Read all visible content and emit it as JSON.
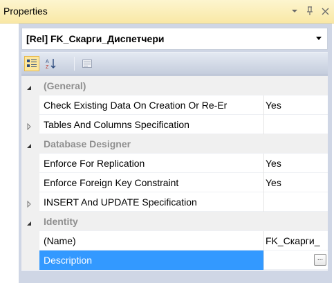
{
  "panel": {
    "title": "Properties",
    "pin_glyph": "▾ ⊥",
    "close_glyph": "✕"
  },
  "object_selector": {
    "value": "[Rel] FK_Скарги_Диспетчери"
  },
  "toolbar": {
    "categorized_icon": "categorized-icon",
    "alphabetical_icon": "alphabetical-icon",
    "property_pages_icon": "property-pages-icon"
  },
  "grid": {
    "categories": [
      {
        "label": "(General)",
        "expanded": true,
        "properties": [
          {
            "name": "Check Existing Data On Creation Or Re-Er",
            "value": "Yes",
            "expandable": false
          },
          {
            "name": "Tables And Columns Specification",
            "value": "",
            "expandable": true
          }
        ]
      },
      {
        "label": "Database Designer",
        "expanded": true,
        "properties": [
          {
            "name": "Enforce For Replication",
            "value": "Yes",
            "expandable": false
          },
          {
            "name": "Enforce Foreign Key Constraint",
            "value": "Yes",
            "expandable": false
          },
          {
            "name": "INSERT And UPDATE Specification",
            "value": "",
            "expandable": true
          }
        ]
      },
      {
        "label": "Identity",
        "expanded": true,
        "properties": [
          {
            "name": "(Name)",
            "value": "FK_Скарги_",
            "expandable": false
          },
          {
            "name": "Description",
            "value": "",
            "expandable": false,
            "selected": true,
            "ellipsis": "..."
          }
        ]
      }
    ]
  },
  "colors": {
    "title_bar": "#f9e8a6",
    "frame": "#cfd6e5",
    "selection": "#3399ff",
    "category_text": "#8f8f8f"
  }
}
